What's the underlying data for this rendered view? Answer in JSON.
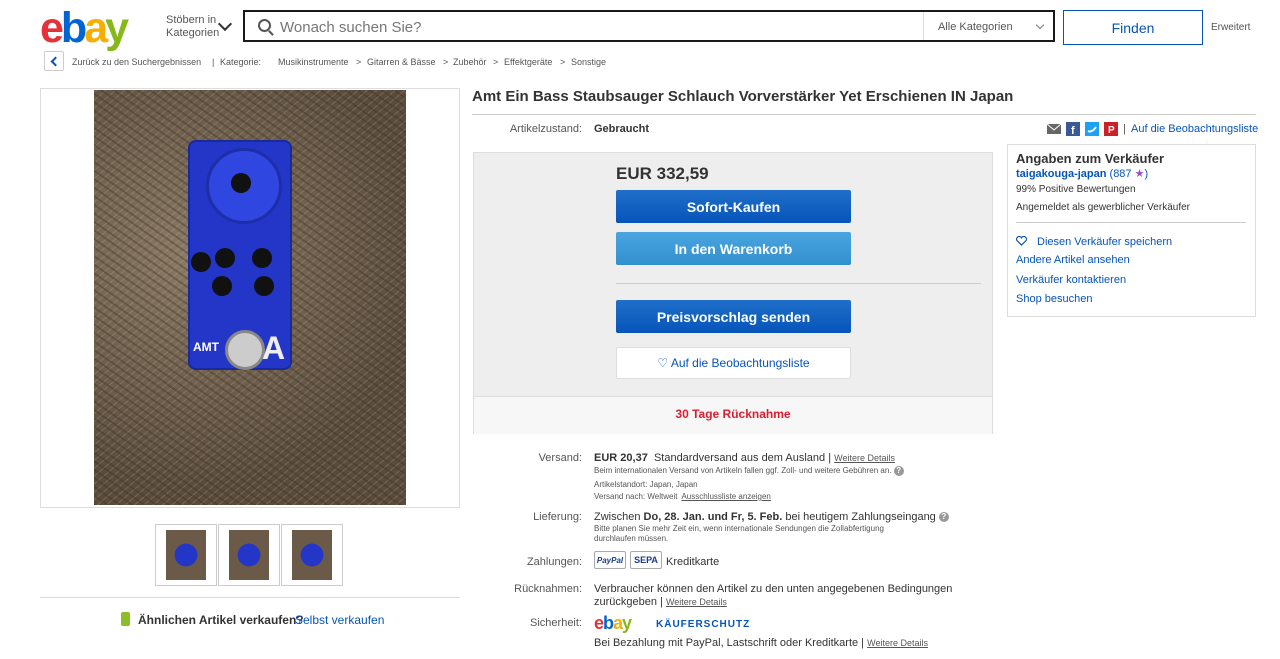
{
  "header": {
    "logo": {
      "e": "e",
      "b": "b",
      "a": "a",
      "y": "y",
      "colors": {
        "e": "#e53238",
        "b": "#0064d2",
        "a": "#f5af02",
        "y": "#86b817"
      }
    },
    "browse_line1": "Stöbern in",
    "browse_line2": "Kategorien",
    "search_placeholder": "Wonach suchen Sie?",
    "category": "Alle Kategorien",
    "find_button": "Finden",
    "advanced": "Erweitert"
  },
  "breadcrumb": {
    "back": "Zurück zu den Suchergebnissen",
    "separator": "|",
    "category_label": "Kategorie:",
    "items": [
      "Musikinstrumente",
      "Gitarren & Bässe",
      "Zubehör",
      "Effektgeräte",
      "Sonstige"
    ],
    "arrow": ">"
  },
  "gallery": {
    "sell_question": "Ähnlichen Artikel verkaufen?",
    "sell_link": "Selbst verkaufen",
    "pedal_brand": "AMT",
    "pedal_letter": "A"
  },
  "item": {
    "title": "Amt Ein Bass Staubsauger Schlauch Vorverstärker Yet Erschienen IN Japan",
    "condition_label": "Artikelzustand:",
    "condition_value": "Gebraucht",
    "watch_link": "Auf die Beobachtungsliste",
    "share_separator": "|"
  },
  "buybox": {
    "price": "EUR 332,59",
    "buy_now": "Sofort-Kaufen",
    "add_to_cart": "In den Warenkorb",
    "make_offer": "Preisvorschlag senden",
    "watch": "♡ Auf die Beobachtungsliste",
    "returns": "30 Tage Rücknahme"
  },
  "seller": {
    "heading": "Angaben zum Verkäufer",
    "name": "taigakouga-japan",
    "score": "(887",
    "score_end": ")",
    "positive": "99% Positive Bewertungen",
    "registered": "Angemeldet als gewerblicher Verkäufer",
    "save": "Diesen Verkäufer speichern",
    "other_items": "Andere Artikel ansehen",
    "contact": "Verkäufer kontaktieren",
    "shop": "Shop besuchen"
  },
  "details": {
    "shipping_label": "Versand:",
    "shipping_price": "EUR 20,37",
    "shipping_type": "Standardversand aus dem Ausland |",
    "more_details": "Weitere Details",
    "shipping_note": "Beim internationalen Versand von Artikeln fallen ggf. Zoll- und weitere Gebühren an.",
    "location": "Artikelstandort:  Japan, Japan",
    "ships_to": "Versand nach:  Weltweit",
    "exclusions": "Ausschlussliste anzeigen",
    "delivery_label": "Lieferung:",
    "delivery_prefix": "Zwischen",
    "delivery_dates": "Do, 28. Jan. und Fr, 5. Feb.",
    "delivery_suffix": "bei heutigem Zahlungseingang",
    "delivery_note1": "Bitte planen Sie mehr Zeit ein, wenn internationale Sendungen die Zollabfertigung",
    "delivery_note2": "durchlaufen müssen.",
    "payment_label": "Zahlungen:",
    "paypal": "PayPal",
    "sepa": "SEPA",
    "credit_card": "Kreditkarte",
    "returns_label": "Rücknahmen:",
    "returns_text1": "Verbraucher können den Artikel zu den unten angegebenen Bedingungen",
    "returns_text2": "zurückgeben |",
    "security_label": "Sicherheit:",
    "buyer_protection": "KÄUFERSCHUTZ",
    "security_text": "Bei Bezahlung mit PayPal, Lastschrift oder Kreditkarte |",
    "help_glyph": "?"
  }
}
